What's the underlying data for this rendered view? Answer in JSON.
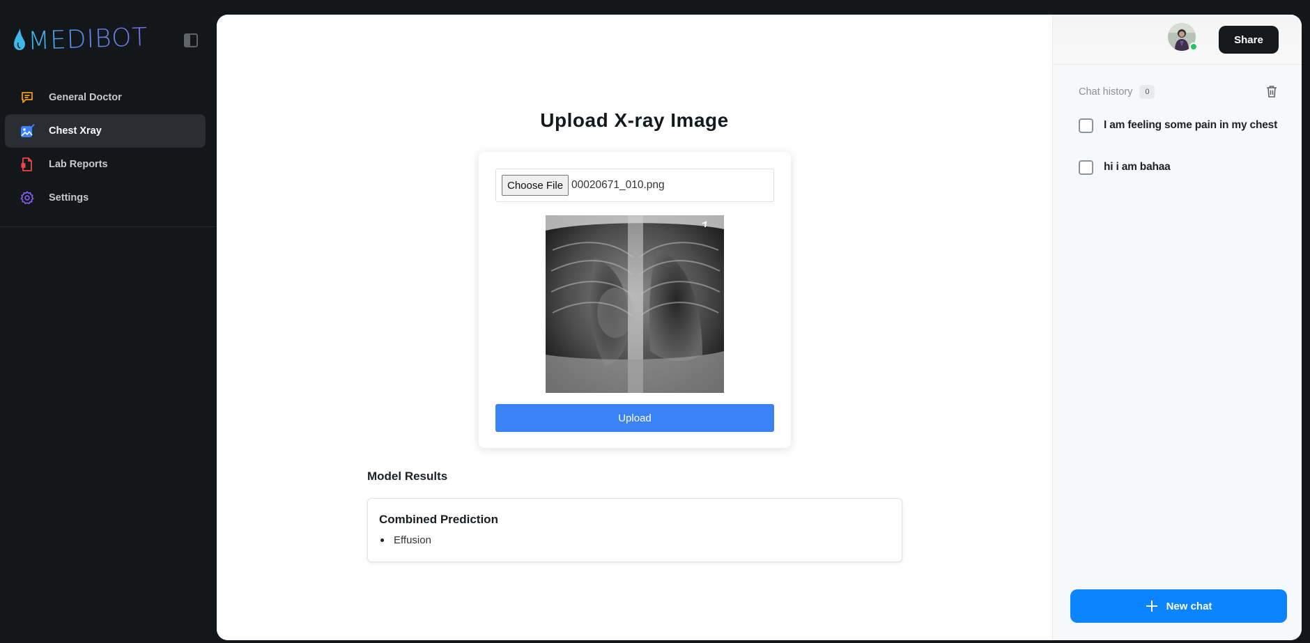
{
  "app": {
    "logo_text": "MEDIBOT"
  },
  "sidebar": {
    "items": [
      {
        "label": "General Doctor",
        "icon": "chat-bubble-icon",
        "color": "#f59e0b",
        "active": false
      },
      {
        "label": "Chest Xray",
        "icon": "image-check-icon",
        "color": "#3b82f6",
        "active": true
      },
      {
        "label": "Lab Reports",
        "icon": "document-icon",
        "color": "#ef4444",
        "active": false
      },
      {
        "label": "Settings",
        "icon": "gear-icon",
        "color": "#8b5cf6",
        "active": false
      }
    ]
  },
  "upload": {
    "title": "Upload X-ray Image",
    "choose_file_label": "Choose File",
    "file_name": "00020671_010.png",
    "button_label": "Upload",
    "accent": "#3b82f6"
  },
  "results": {
    "title": "Model Results",
    "card_title": "Combined Prediction",
    "predictions": [
      "Effusion"
    ]
  },
  "right_panel": {
    "share_label": "Share",
    "history_label": "Chat history",
    "history_count": "0",
    "history": [
      "I am feeling some pain in my chest",
      "hi i am bahaa"
    ],
    "new_chat_label": "New chat",
    "new_chat_color": "#0a84ff",
    "status_color": "#22c55e"
  }
}
